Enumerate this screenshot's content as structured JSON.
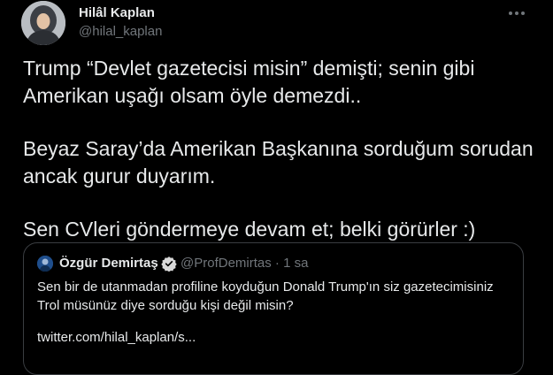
{
  "tweet": {
    "author": {
      "name": "Hilâl Kaplan",
      "handle": "@hilal_kaplan"
    },
    "text_lines": [
      "Trump “Devlet gazetecisi misin” demişti; senin gibi",
      "Amerikan uşağı olsam öyle demezdi..",
      "Beyaz Saray’da Amerikan Başkanına sorduğum sorudan",
      "ancak gurur duyarım.",
      "Sen CVleri göndermeye devam et; belki görürler :)"
    ],
    "more_icon": "more-horizontal-icon"
  },
  "quote": {
    "author": {
      "name": "Özgür Demirtaş",
      "handle": "@ProfDemirtas · 1 sa",
      "verified_icon": "verified-badge-icon"
    },
    "text_lines": [
      "Sen bir de utanmadan profiline koyduğun Donald Trump'ın siz gazetecimisiniz",
      "Trol müsünüz diye sorduğu kişi değil misin?"
    ],
    "link": "twitter.com/hilal_kaplan/s..."
  },
  "colors": {
    "background": "#000000",
    "text_primary": "#e7e9ea",
    "text_secondary": "#71767b",
    "border": "#3a3d41",
    "verified_blue": "#1d9bf0"
  }
}
